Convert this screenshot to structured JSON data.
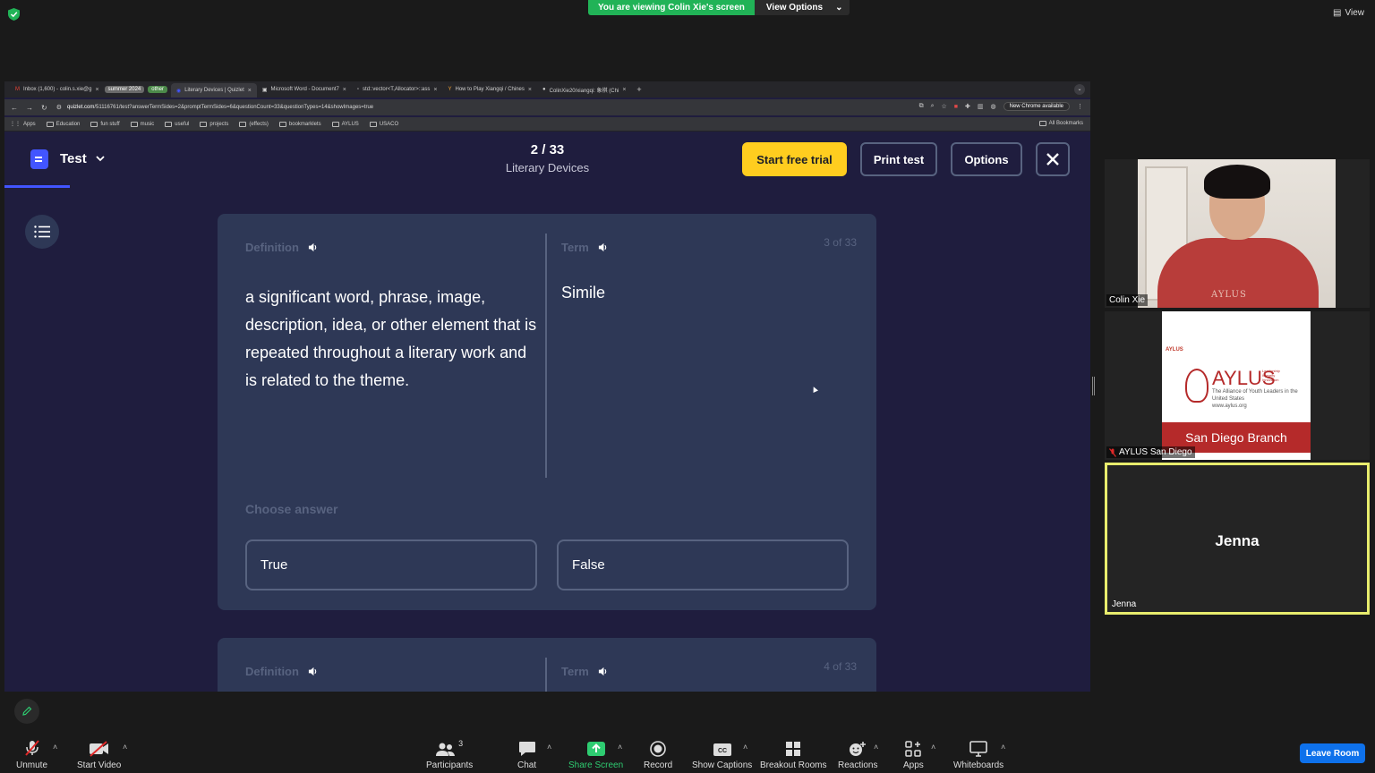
{
  "zoom": {
    "viewing_banner": "You are viewing Colin Xie's screen",
    "view_options": "View Options",
    "view_button": "View",
    "leave_room": "Leave Room",
    "toolbar": {
      "unmute": "Unmute",
      "start_video": "Start Video",
      "participants": "Participants",
      "participants_count": "3",
      "chat": "Chat",
      "share_screen": "Share Screen",
      "record": "Record",
      "show_captions": "Show Captions",
      "breakout_rooms": "Breakout Rooms",
      "reactions": "Reactions",
      "apps": "Apps",
      "whiteboards": "Whiteboards"
    },
    "participants": [
      {
        "name": "Colin Xie",
        "shirt_text": "AYLUS"
      },
      {
        "name": "AYLUS San Diego"
      },
      {
        "name": "Jenna",
        "display": "Jenna"
      }
    ],
    "aylus_logo": {
      "top": "AYLUS",
      "word": "AYLUS",
      "tagline": "Leadership Integrity Innovation",
      "subtitle": "The Alliance of Youth Leaders in the United States",
      "url": "www.aylus.org",
      "band": "San Diego Branch"
    }
  },
  "browser": {
    "tabs": [
      {
        "label": "Inbox (1,600) - colin.s.xie@g",
        "icon": "gmail-icon"
      },
      {
        "chip": "summer 2024",
        "chip_color": "#6a6a6a"
      },
      {
        "chip": "other",
        "chip_color": "#4c8a4a"
      },
      {
        "label": "Literary Devices | Quizlet",
        "active": true
      },
      {
        "label": "Microsoft Word - Document7"
      },
      {
        "label": "std::vector<T,Allocator>::ass"
      },
      {
        "label": "How to Play Xiangqi / Chines"
      },
      {
        "label": "ColinXie20/xiangqi: 象棋 (Chi"
      }
    ],
    "url_host": "quizlet.com",
    "url_path": "/51116761/test?answerTermSides=2&promptTermSides=6&questionCount=33&questionTypes=14&showImages=true",
    "new_chrome": "New Chrome available",
    "bookmarks": [
      "Apps",
      "Education",
      "fun stuff",
      "music",
      "useful",
      "projects",
      "(effects)",
      "bookmarklets",
      "AYLUS",
      "USACO"
    ],
    "all_bookmarks": "All Bookmarks"
  },
  "quizlet": {
    "mode": "Test",
    "progress": "2 / 33",
    "set_title": "Literary Devices",
    "start_trial": "Start free trial",
    "print_test": "Print test",
    "options": "Options",
    "close": "✕",
    "question": {
      "definition_label": "Definition",
      "term_label": "Term",
      "count": "3 of 33",
      "definition": "a significant word, phrase, image, description, idea, or other element that is repeated throughout a literary work and is related to the theme.",
      "term": "Simile",
      "choose": "Choose answer",
      "answers": [
        "True",
        "False"
      ]
    },
    "next_question": {
      "definition_label": "Definition",
      "term_label": "Term",
      "count": "4 of 33"
    }
  }
}
